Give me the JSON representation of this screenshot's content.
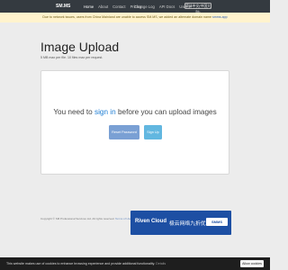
{
  "navbar": {
    "brand": "SM.MS",
    "links": [
      "Home",
      "About",
      "Contact",
      "Pricing"
    ],
    "right": [
      "Change Log",
      "API Docs",
      "User"
    ],
    "lang_button": "简体中文(中国大陆)"
  },
  "notice": {
    "text": "Due to network issues, users from China Mainland are unable to access SM.MS, we added an alternate domain name",
    "link": "smms.app"
  },
  "main": {
    "title": "Image Upload",
    "subtitle": "5 MB max per file. 10 files max per request."
  },
  "card": {
    "msg_before": "You need to",
    "msg_link": "sign in",
    "msg_after": "before you can upload images",
    "reset_button": "Reset Password",
    "signup_button": "Sign Up"
  },
  "footer": {
    "copyright": "Copyright © SM Professional Services Ltd. All rights reserved.",
    "terms": "Terms of Use",
    "privacy": "Privacy Policy"
  },
  "ad": {
    "brand": "Riven Cloud",
    "text": "极云网络九折优惠码",
    "badge": "SMMS"
  },
  "cookie": {
    "text": "This website makes use of cookies to enhance browsing experience and provide additional functionality.",
    "details": "Details",
    "allow": "Allow cookies"
  }
}
